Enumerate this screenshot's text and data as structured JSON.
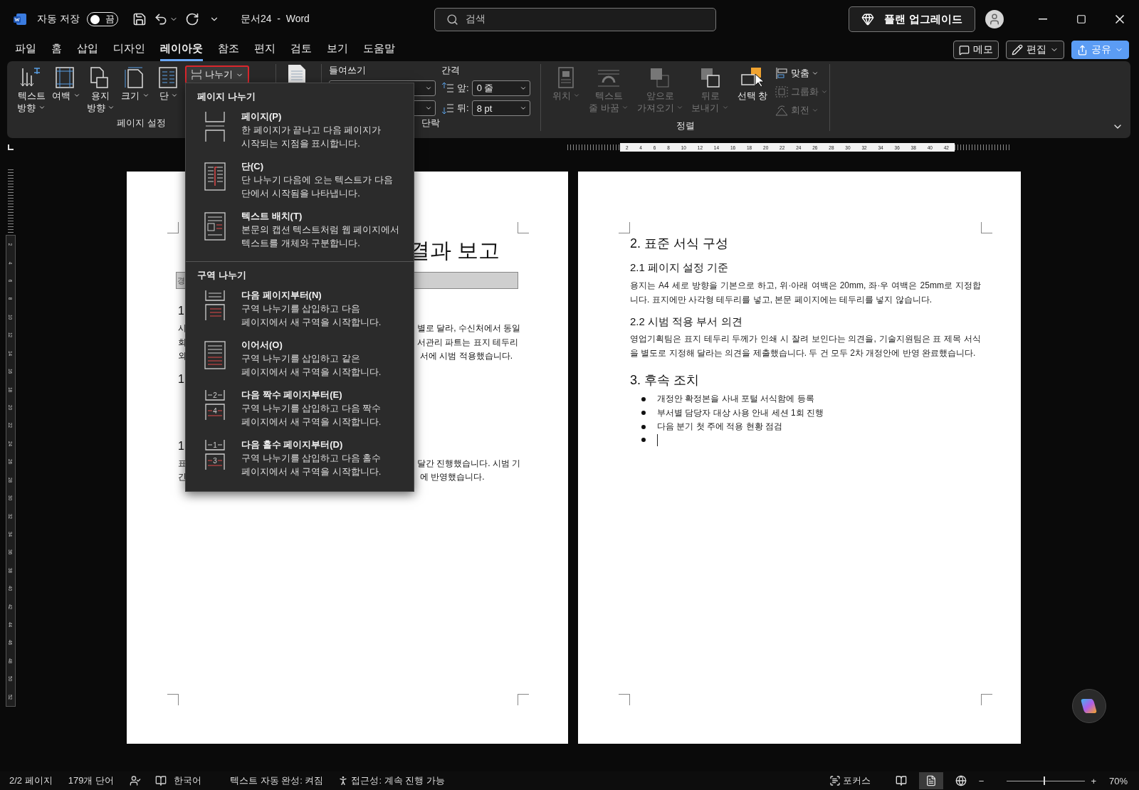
{
  "app": {
    "title": "문서24  -  Word",
    "autosave": {
      "label": "자동 저장",
      "on": false,
      "state_text": "끔"
    },
    "search": {
      "placeholder": "검색"
    },
    "upgrade_button": "플랜 업그레이드"
  },
  "tabs": [
    {
      "label": "파일",
      "selected": false
    },
    {
      "label": "홈",
      "selected": false
    },
    {
      "label": "삽입",
      "selected": false
    },
    {
      "label": "디자인",
      "selected": false
    },
    {
      "label": "레이아웃",
      "selected": true
    },
    {
      "label": "참조",
      "selected": false
    },
    {
      "label": "편지",
      "selected": false
    },
    {
      "label": "검토",
      "selected": false
    },
    {
      "label": "보기",
      "selected": false
    },
    {
      "label": "도움말",
      "selected": false
    }
  ],
  "tab_actions": {
    "memo": "메모",
    "edit": "편집",
    "share": "공유"
  },
  "ribbon": {
    "page_setup": {
      "label": "페이지 설정",
      "buttons": [
        {
          "kind": "text-direction",
          "lines": [
            "텍스트",
            "방향"
          ],
          "dropdown": true
        },
        {
          "kind": "margins",
          "lines": [
            "여백"
          ],
          "dropdown": true
        },
        {
          "kind": "orientation",
          "lines": [
            "용지",
            "방향"
          ],
          "dropdown": true
        },
        {
          "kind": "size",
          "lines": [
            "크기"
          ],
          "dropdown": true
        },
        {
          "kind": "columns",
          "lines": [
            "단"
          ],
          "dropdown": true
        }
      ],
      "breaks": {
        "label": "나누기",
        "expanded": true,
        "highlighted": true
      }
    },
    "paragraph": {
      "label": "단락",
      "indent_label": "들여쓰기",
      "spacing_label": "간격",
      "spacing": [
        {
          "kind": "before",
          "label": "앞:",
          "value": "0 줄"
        },
        {
          "kind": "after",
          "label": "뒤:",
          "value": "8 pt"
        }
      ]
    },
    "arrange": {
      "label": "정렬",
      "buttons": [
        {
          "kind": "position",
          "lines": [
            "위치"
          ],
          "dropdown": true,
          "disabled": true
        },
        {
          "kind": "wrap",
          "lines": [
            "텍스트",
            "줄 바꿈"
          ],
          "dropdown": true,
          "disabled": true
        },
        {
          "kind": "forward",
          "lines": [
            "앞으로",
            "가져오기"
          ],
          "dropdown": true,
          "disabled": true
        },
        {
          "kind": "backward",
          "lines": [
            "뒤로",
            "보내기"
          ],
          "dropdown": true,
          "disabled": true
        },
        {
          "kind": "selection",
          "lines": [
            "선택 창"
          ],
          "dropdown": false,
          "disabled": false
        }
      ],
      "small": [
        {
          "kind": "align",
          "label": "맞춤",
          "disabled": false
        },
        {
          "kind": "group",
          "label": "그룹화",
          "disabled": true
        },
        {
          "kind": "rotate",
          "label": "회전",
          "disabled": true
        }
      ]
    }
  },
  "ruler": {
    "labels": [
      "2",
      "4",
      "6",
      "8",
      "10",
      "12",
      "14",
      "16",
      "18",
      "20",
      "22",
      "24",
      "26",
      "28",
      "30",
      "32",
      "34",
      "36",
      "38",
      "40",
      "42"
    ],
    "vertical_labels": [
      "2",
      "4",
      "6",
      "8",
      "10",
      "12",
      "14",
      "16",
      "18",
      "20",
      "22",
      "24",
      "26",
      "28",
      "30",
      "32",
      "34",
      "36",
      "38",
      "40",
      "42",
      "44",
      "46",
      "48",
      "50",
      "52"
    ]
  },
  "breaks_menu": {
    "sections": [
      {
        "heading": "페이지 나누기",
        "items": [
          {
            "kind": "page",
            "title": "페이지(P)",
            "description": [
              "한 페이지가 끝나고 다음 페이지가",
              "시작되는 지점을 표시합니다."
            ]
          },
          {
            "kind": "column",
            "title": "단(C)",
            "description": [
              "단 나누기 다음에 오는 텍스트가 다음",
              "단에서 시작됨을 나타냅니다."
            ]
          },
          {
            "kind": "wrapping",
            "title": "텍스트 배치(T)",
            "description": [
              "본문의 캡션 텍스트처럼 웹 페이지에서",
              "텍스트를 개체와 구분합니다."
            ]
          }
        ]
      },
      {
        "heading": "구역 나누기",
        "items": [
          {
            "kind": "next-page",
            "title": "다음 페이지부터(N)",
            "description": [
              "구역 나누기를 삽입하고 다음",
              "페이지에서 새 구역을 시작합니다."
            ]
          },
          {
            "kind": "continuous",
            "title": "이어서(O)",
            "description": [
              "구역 나누기를 삽입하고 같은",
              "페이지에서 새 구역을 시작합니다."
            ]
          },
          {
            "kind": "even",
            "title": "다음 짝수 페이지부터(E)",
            "icon_numbers": [
              "2",
              "4"
            ],
            "description": [
              "구역 나누기를 삽입하고 다음 짝수",
              "페이지에서 새 구역을 시작합니다."
            ]
          },
          {
            "kind": "odd",
            "title": "다음 홀수 페이지부터(D)",
            "icon_numbers": [
              "1",
              "3"
            ],
            "description": [
              "구역 나누기를 삽입하고 다음 홀수",
              "페이지에서 새 구역을 시작합니다."
            ]
          }
        ]
      }
    ]
  },
  "left_page": {
    "title_fragment": "결과 보고",
    "bar_fragment": "경",
    "blocks": [
      {
        "kind": "heading",
        "text": "1"
      },
      {
        "kind": "lines",
        "lines": [
          {
            "left": "시",
            "right": "별로 달라, 수신처에서 동일"
          },
          {
            "left": "회",
            "right": "서관리 파트는 표지 테두리"
          },
          {
            "left": "외",
            "right": "서에 시범 적용했습니다."
          }
        ]
      },
      {
        "kind": "heading",
        "text": "1"
      },
      {
        "kind": "heading",
        "text": "1"
      },
      {
        "kind": "lines",
        "lines": [
          {
            "left": "표",
            "right": "달간 진행했습니다. 시범 기"
          },
          {
            "left": "간",
            "right": "에 반영했습니다."
          }
        ]
      }
    ]
  },
  "right_page": {
    "blocks": [
      {
        "kind": "h1",
        "text": "2. 표준 서식 구성"
      },
      {
        "kind": "h2",
        "text": "2.1 페이지 설정 기준"
      },
      {
        "kind": "para",
        "text": "용지는 A4 세로 방향을 기본으로 하고, 위·아래 여백은 20mm, 좌·우 여백은 25mm로 지정합니다. 표지에만 사각형 테두리를 넣고, 본문 페이지에는 테두리를 넣지 않습니다."
      },
      {
        "kind": "h2",
        "text": "2.2 시범 적용 부서 의견"
      },
      {
        "kind": "para",
        "text": "영업기획팀은 표지 테두리 두께가 인쇄 시 잘려 보인다는 의견을, 기술지원팀은 표 제목 서식을 별도로 지정해 달라는 의견을 제출했습니다. 두 건 모두 2차 개정안에 반영 완료했습니다."
      },
      {
        "kind": "h1",
        "text": "3. 후속 조치"
      },
      {
        "kind": "bullets",
        "items": [
          "개정안 확정본을 사내 포털 서식함에 등록",
          "부서별 담당자 대상 사용 안내 세션 1회 진행",
          "다음 분기 첫 주에 적용 현황 점검"
        ],
        "cursor_item": true
      }
    ]
  },
  "status_bar": {
    "page": "2/2 페이지",
    "words": "179개 단어",
    "language": "한국어",
    "autocomplete": "텍스트 자동 완성: 켜짐",
    "accessibility": "접근성: 계속 진행 가능",
    "focus": "포커스",
    "views": [
      {
        "kind": "read",
        "selected": false
      },
      {
        "kind": "print",
        "selected": true
      },
      {
        "kind": "web",
        "selected": false
      }
    ],
    "zoom": {
      "minus": "−",
      "plus": "+",
      "level": 0.47,
      "reading": "70%"
    }
  }
}
